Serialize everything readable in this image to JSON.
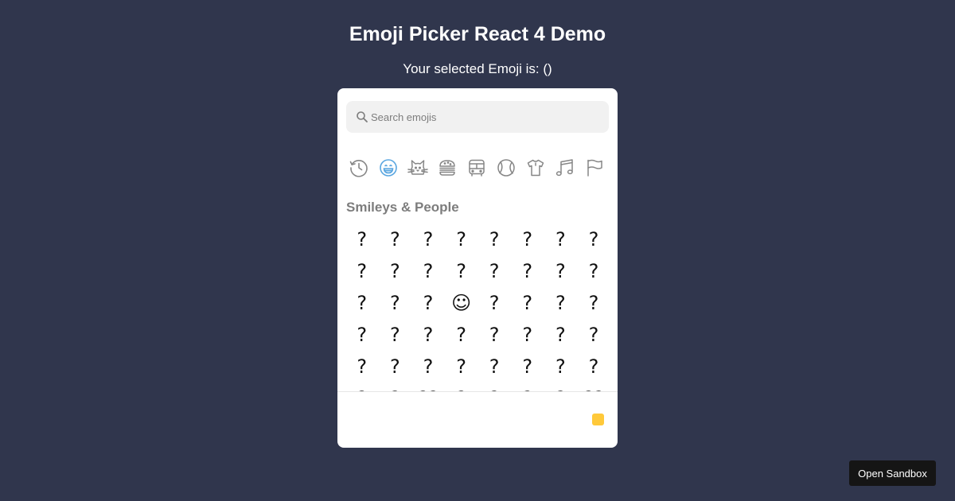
{
  "header": {
    "title": "Emoji Picker React 4 Demo",
    "selected_label": "Your selected Emoji is: ()"
  },
  "picker": {
    "search": {
      "placeholder": "Search emojis",
      "value": ""
    },
    "categories": [
      {
        "name": "Frequently Used",
        "icon": "clock-icon",
        "active": false
      },
      {
        "name": "Smileys & People",
        "icon": "smiley-icon",
        "active": true
      },
      {
        "name": "Animals & Nature",
        "icon": "cat-icon",
        "active": false
      },
      {
        "name": "Food & Drink",
        "icon": "burger-icon",
        "active": false
      },
      {
        "name": "Travel & Places",
        "icon": "bus-icon",
        "active": false
      },
      {
        "name": "Activities",
        "icon": "ball-icon",
        "active": false
      },
      {
        "name": "Objects",
        "icon": "shirt-icon",
        "active": false
      },
      {
        "name": "Symbols",
        "icon": "music-icon",
        "active": false
      },
      {
        "name": "Flags",
        "icon": "flag-icon",
        "active": false
      }
    ],
    "section_label": "Smileys & People",
    "emojis": [
      "?",
      "?",
      "?",
      "?",
      "?",
      "?",
      "?",
      "?",
      "?",
      "?",
      "?",
      "?",
      "?",
      "?",
      "?",
      "?",
      "?",
      "?",
      "?",
      "☺",
      "?",
      "?",
      "?",
      "?",
      "?",
      "?",
      "?",
      "?",
      "?",
      "?",
      "?",
      "?",
      "?",
      "?",
      "?",
      "?",
      "?",
      "?",
      "?",
      "?",
      "?",
      "?",
      "??",
      "?",
      "?",
      "?",
      "?",
      "??"
    ],
    "skin_tone_color": "#ffc93a",
    "active_category_color": "#5aa6e0",
    "icon_color": "#868686"
  },
  "sandbox": {
    "label": "Open Sandbox"
  }
}
